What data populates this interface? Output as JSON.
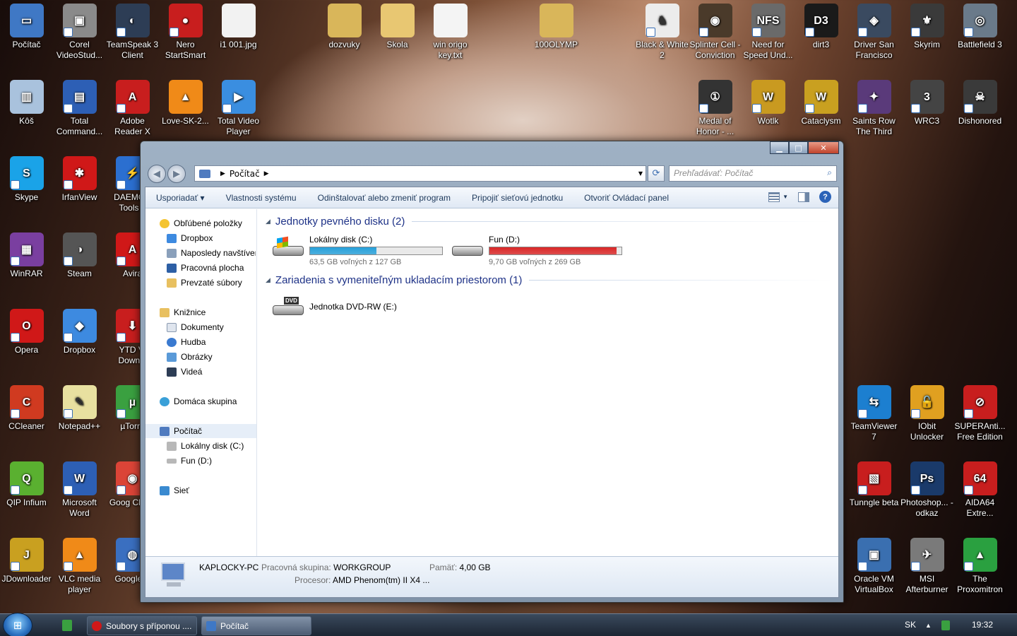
{
  "desktop_icons": [
    {
      "label": "Počítač",
      "x": 0,
      "y": 0,
      "color": "#3f78c5",
      "glyph": "▭",
      "icon": "computer-icon",
      "arrow": false
    },
    {
      "label": "Corel VideoStud...",
      "color": "#8a8a8a",
      "glyph": "▣",
      "icon": "corel-video-icon"
    },
    {
      "label": "TeamSpeak 3 Client",
      "color": "#2d3d55",
      "glyph": "◐",
      "icon": "teamspeak-icon"
    },
    {
      "label": "Nero StartSmart",
      "color": "#c81e1e",
      "glyph": "●",
      "icon": "nero-icon"
    },
    {
      "label": "i1 001.jpg",
      "color": "#f2f2f2",
      "glyph": "",
      "icon": "image-file-icon",
      "arrow": false
    },
    {
      "label": "dozvuky",
      "color": "#d9b65a",
      "glyph": "",
      "icon": "folder-icon",
      "arrow": false
    },
    {
      "label": "Skola",
      "color": "#e8c772",
      "glyph": "",
      "icon": "folder-icon",
      "arrow": false
    },
    {
      "label": "win origo key.txt",
      "color": "#f4f4f4",
      "glyph": "",
      "icon": "text-file-icon",
      "arrow": false
    },
    {
      "label": "100OLYMP",
      "color": "#d9b65a",
      "glyph": "",
      "icon": "folder-icon",
      "arrow": false
    },
    {
      "label": "Black & White 2",
      "color": "#ececec",
      "glyph": "♞",
      "icon": "black-white-icon"
    },
    {
      "label": "Splinter Cell - Conviction",
      "color": "#4a3a2a",
      "glyph": "◉",
      "icon": "splinter-cell-icon"
    },
    {
      "label": "Need for Speed Und...",
      "color": "#6a6a6a",
      "glyph": "NFS",
      "icon": "nfs-icon"
    },
    {
      "label": "dirt3",
      "color": "#1a1a1a",
      "glyph": "D3",
      "icon": "dirt3-icon"
    },
    {
      "label": "Driver San Francisco",
      "color": "#3a4a60",
      "glyph": "◈",
      "icon": "driver-icon"
    },
    {
      "label": "Skyrim",
      "color": "#3a3a3a",
      "glyph": "⚜",
      "icon": "skyrim-icon"
    },
    {
      "label": "Battlefield 3",
      "color": "#6a7a8a",
      "glyph": "◎",
      "icon": "battlefield-icon"
    },
    {
      "label": "Kôš",
      "color": "#a9c2dd",
      "glyph": "▥",
      "icon": "recycle-bin-icon",
      "arrow": false
    },
    {
      "label": "Total Command...",
      "color": "#2d5fb5",
      "glyph": "▤",
      "icon": "total-commander-icon"
    },
    {
      "label": "Adobe Reader X",
      "color": "#c81e1e",
      "glyph": "A",
      "icon": "adobe-reader-icon"
    },
    {
      "label": "Love-SK-2...",
      "color": "#f08a18",
      "glyph": "▲",
      "icon": "vlc-file-icon",
      "arrow": false
    },
    {
      "label": "Total Video Player",
      "color": "#3a8ee0",
      "glyph": "▶",
      "icon": "total-video-icon"
    },
    {
      "label": "Medal of Honor - ...",
      "color": "#333",
      "glyph": "①",
      "icon": "medal-of-honor-icon"
    },
    {
      "label": "Wotlk",
      "color": "#c99a20",
      "glyph": "W",
      "icon": "wotlk-icon"
    },
    {
      "label": "Cataclysm",
      "color": "#c9a020",
      "glyph": "W",
      "icon": "cataclysm-icon"
    },
    {
      "label": "Saints Row The Third",
      "color": "#5a3a7a",
      "glyph": "✦",
      "icon": "saints-row-icon"
    },
    {
      "label": "WRC3",
      "color": "#444",
      "glyph": "3",
      "icon": "wrc3-icon"
    },
    {
      "label": "Dishonored",
      "color": "#3a3a3a",
      "glyph": "☠",
      "icon": "dishonored-icon"
    },
    {
      "label": "Skype",
      "color": "#1aa3e8",
      "glyph": "S",
      "icon": "skype-icon"
    },
    {
      "label": "IrfanView",
      "color": "#d01818",
      "glyph": "✱",
      "icon": "irfanview-icon"
    },
    {
      "label": "DAEMON Tools L",
      "color": "#2b6fd0",
      "glyph": "⚡",
      "icon": "daemon-tools-icon"
    },
    {
      "label": "WinRAR",
      "color": "#7a3fa0",
      "glyph": "▦",
      "icon": "winrar-icon"
    },
    {
      "label": "Steam",
      "color": "#555",
      "glyph": "◑",
      "icon": "steam-icon"
    },
    {
      "label": "Avira",
      "color": "#d01818",
      "glyph": "A",
      "icon": "avira-icon"
    },
    {
      "label": "Opera",
      "color": "#d01818",
      "glyph": "O",
      "icon": "opera-icon"
    },
    {
      "label": "Dropbox",
      "color": "#3d8ae0",
      "glyph": "◆",
      "icon": "dropbox-icon"
    },
    {
      "label": "YTD Vi Downlo",
      "color": "#c81e1e",
      "glyph": "⬇",
      "icon": "ytd-icon"
    },
    {
      "label": "CCleaner",
      "color": "#d03a20",
      "glyph": "C",
      "icon": "ccleaner-icon"
    },
    {
      "label": "Notepad++",
      "color": "#e8e0a0",
      "glyph": "✎",
      "icon": "notepadpp-icon"
    },
    {
      "label": "µTorre",
      "color": "#3aa040",
      "glyph": "µ",
      "icon": "utorrent-icon"
    },
    {
      "label": "QIP Infium",
      "color": "#5ab030",
      "glyph": "Q",
      "icon": "qip-icon"
    },
    {
      "label": "Microsoft Word",
      "color": "#2d5fb5",
      "glyph": "W",
      "icon": "word-icon"
    },
    {
      "label": "Goog Chron",
      "color": "#db4437",
      "glyph": "◉",
      "icon": "chrome-icon"
    },
    {
      "label": "JDownloader",
      "color": "#c9a020",
      "glyph": "J",
      "icon": "jdownloader-icon"
    },
    {
      "label": "VLC media player",
      "color": "#f08a18",
      "glyph": "▲",
      "icon": "vlc-icon"
    },
    {
      "label": "Google E",
      "color": "#3a6fc0",
      "glyph": "◍",
      "icon": "google-earth-icon"
    },
    {
      "label": "TeamViewer 7",
      "color": "#1c7fd0",
      "glyph": "⇆",
      "icon": "teamviewer-icon"
    },
    {
      "label": "IObit Unlocker",
      "color": "#e0a020",
      "glyph": "🔓",
      "icon": "iobit-unlocker-icon"
    },
    {
      "label": "SUPERAnti... Free Edition",
      "color": "#c81e1e",
      "glyph": "⊘",
      "icon": "superantispyware-icon"
    },
    {
      "label": "Tunngle beta",
      "color": "#c81e1e",
      "glyph": "▧",
      "icon": "tunngle-icon"
    },
    {
      "label": "Photoshop... - odkaz",
      "color": "#1a3a6a",
      "glyph": "Ps",
      "icon": "photoshop-icon"
    },
    {
      "label": "AIDA64 Extre...",
      "color": "#c81e1e",
      "glyph": "64",
      "icon": "aida64-icon"
    },
    {
      "label": "Oracle VM VirtualBox",
      "color": "#3a6fb0",
      "glyph": "▣",
      "icon": "virtualbox-icon"
    },
    {
      "label": "MSI Afterburner",
      "color": "#7a7a7a",
      "glyph": "✈",
      "icon": "msi-afterburner-icon"
    },
    {
      "label": "The Proxomitron",
      "color": "#2aa040",
      "glyph": "▲",
      "icon": "proxomitron-icon"
    }
  ],
  "window": {
    "address": {
      "location": "Počítač"
    },
    "search_placeholder": "Prehľadávať: Počítač",
    "commands": [
      "Usporiadať ▾",
      "Vlastnosti systému",
      "Odinštalovať alebo zmeniť program",
      "Pripojiť sieťovú jednotku",
      "Otvoriť Ovládací panel"
    ],
    "nav": {
      "favorites": "Obľúbené položky",
      "dropbox": "Dropbox",
      "recent": "Naposledy navštívené",
      "desktop": "Pracovná plocha",
      "downloads": "Prevzaté súbory",
      "libraries": "Knižnice",
      "documents": "Dokumenty",
      "music": "Hudba",
      "pictures": "Obrázky",
      "videos": "Videá",
      "homegroup": "Domáca skupina",
      "computer": "Počítač",
      "drive_c": "Lokálny disk (C:)",
      "drive_d": "Fun (D:)",
      "network": "Sieť"
    },
    "groups": {
      "hdd": "Jednotky pevného disku (2)",
      "removable": "Zariadenia s vymeniteľným ukladacím priestorom (1)"
    },
    "drives": [
      {
        "name": "Lokálny disk (C:)",
        "free": "63,5 GB voľných z 127 GB",
        "used_fraction": 0.5,
        "bar_color": "#26a0da"
      },
      {
        "name": "Fun (D:)",
        "free": "9,70 GB voľných z 269 GB",
        "used_fraction": 0.964,
        "bar_color": "#da2626"
      }
    ],
    "dvd": "Jednotka DVD-RW (E:)",
    "details": {
      "pc_name": "KAPLOCKY-PC",
      "workgroup_key": "Pracovná skupina:",
      "workgroup_val": "WORKGROUP",
      "memory_key": "Pamäť:",
      "memory_val": "4,00 GB",
      "cpu_key": "Procesor:",
      "cpu_val": "AMD Phenom(tm) II X4 ..."
    }
  },
  "taskbar": {
    "start_icon": "windows-orb",
    "buttons": [
      {
        "label": "Soubory s příponou ....",
        "color": "#d01818",
        "active": false
      },
      {
        "label": "Počítač",
        "color": "#3f78c5",
        "active": true
      }
    ],
    "lang": "SK",
    "time": "19:32"
  }
}
